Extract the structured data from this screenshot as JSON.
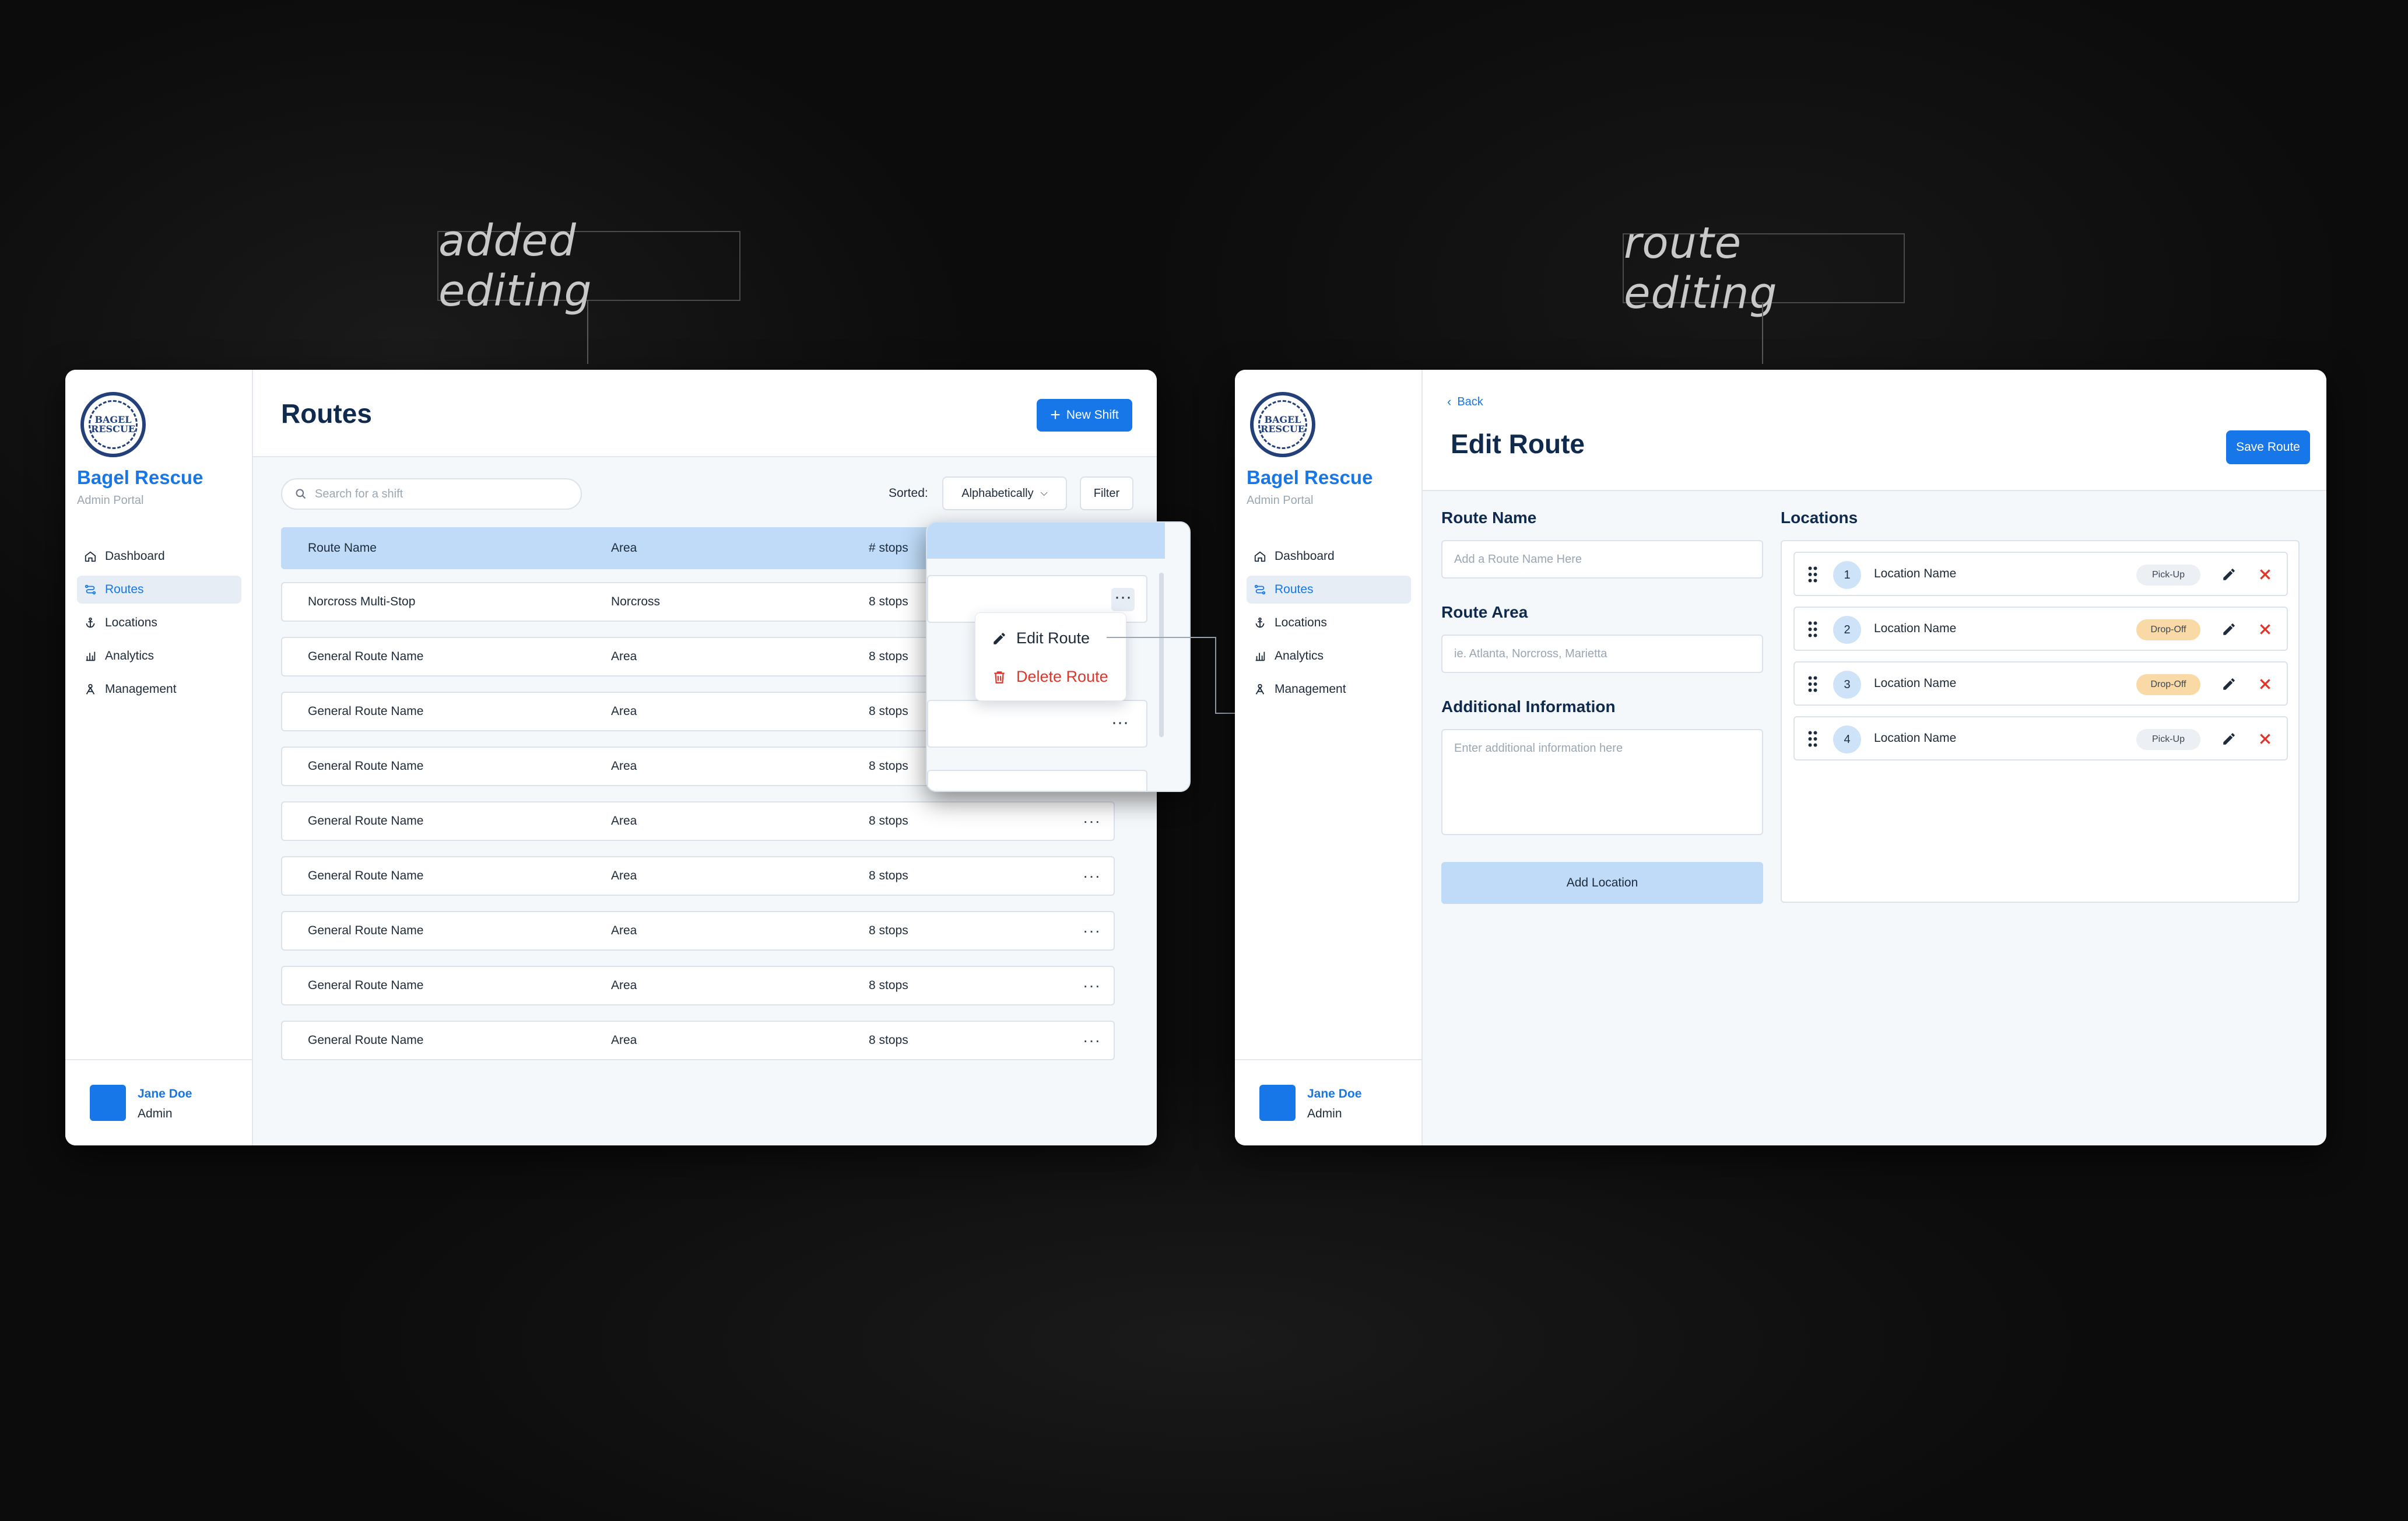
{
  "captions": {
    "left": "added editing",
    "right": "route editing"
  },
  "brand": {
    "name": "Bagel Rescue",
    "subtitle": "Admin Portal",
    "logo_text_top": "BAGEL",
    "logo_text_bottom": "RESCUE"
  },
  "nav": [
    {
      "label": "Dashboard",
      "icon": "home-icon"
    },
    {
      "label": "Routes",
      "icon": "route-icon",
      "active": true
    },
    {
      "label": "Locations",
      "icon": "anchor-icon"
    },
    {
      "label": "Analytics",
      "icon": "bar-chart-icon"
    },
    {
      "label": "Management",
      "icon": "people-icon"
    }
  ],
  "user": {
    "name": "Jane Doe",
    "role": "Admin"
  },
  "routes_page": {
    "title": "Routes",
    "new_button": "New Shift",
    "search_placeholder": "Search for a shift",
    "sorted_label": "Sorted:",
    "sort_value": "Alphabetically",
    "filter_label": "Filter",
    "columns": [
      "Route Name",
      "Area",
      "# stops"
    ],
    "rows": [
      {
        "name": "Norcross Multi-Stop",
        "area": "Norcross",
        "stops": "8 stops"
      },
      {
        "name": "General Route Name",
        "area": "Area",
        "stops": "8 stops"
      },
      {
        "name": "General Route Name",
        "area": "Area",
        "stops": "8 stops"
      },
      {
        "name": "General Route Name",
        "area": "Area",
        "stops": "8 stops"
      },
      {
        "name": "General Route Name",
        "area": "Area",
        "stops": "8 stops"
      },
      {
        "name": "General Route Name",
        "area": "Area",
        "stops": "8 stops"
      },
      {
        "name": "General Route Name",
        "area": "Area",
        "stops": "8 stops"
      },
      {
        "name": "General Route Name",
        "area": "Area",
        "stops": "8 stops"
      },
      {
        "name": "General Route Name",
        "area": "Area",
        "stops": "8 stops"
      }
    ],
    "menu": {
      "edit": "Edit Route",
      "delete": "Delete Route"
    }
  },
  "edit_page": {
    "back": "Back",
    "title": "Edit Route",
    "save_button": "Save Route",
    "route_name_label": "Route Name",
    "route_name_placeholder": "Add a Route Name Here",
    "route_area_label": "Route Area",
    "route_area_placeholder": "ie. Atlanta, Norcross, Marietta",
    "info_label": "Additional Information",
    "info_placeholder": "Enter additional information here",
    "add_location": "Add Location",
    "locations_label": "Locations",
    "locations": [
      {
        "num": "1",
        "name": "Location Name",
        "type": "Pick-Up"
      },
      {
        "num": "2",
        "name": "Location Name",
        "type": "Drop-Off"
      },
      {
        "num": "3",
        "name": "Location Name",
        "type": "Drop-Off"
      },
      {
        "num": "4",
        "name": "Location Name",
        "type": "Pick-Up"
      }
    ]
  },
  "colors": {
    "accent": "#1877e8",
    "header_row": "#bfdbf7",
    "drop_off": "#f9d9a6",
    "danger": "#e0352b"
  }
}
